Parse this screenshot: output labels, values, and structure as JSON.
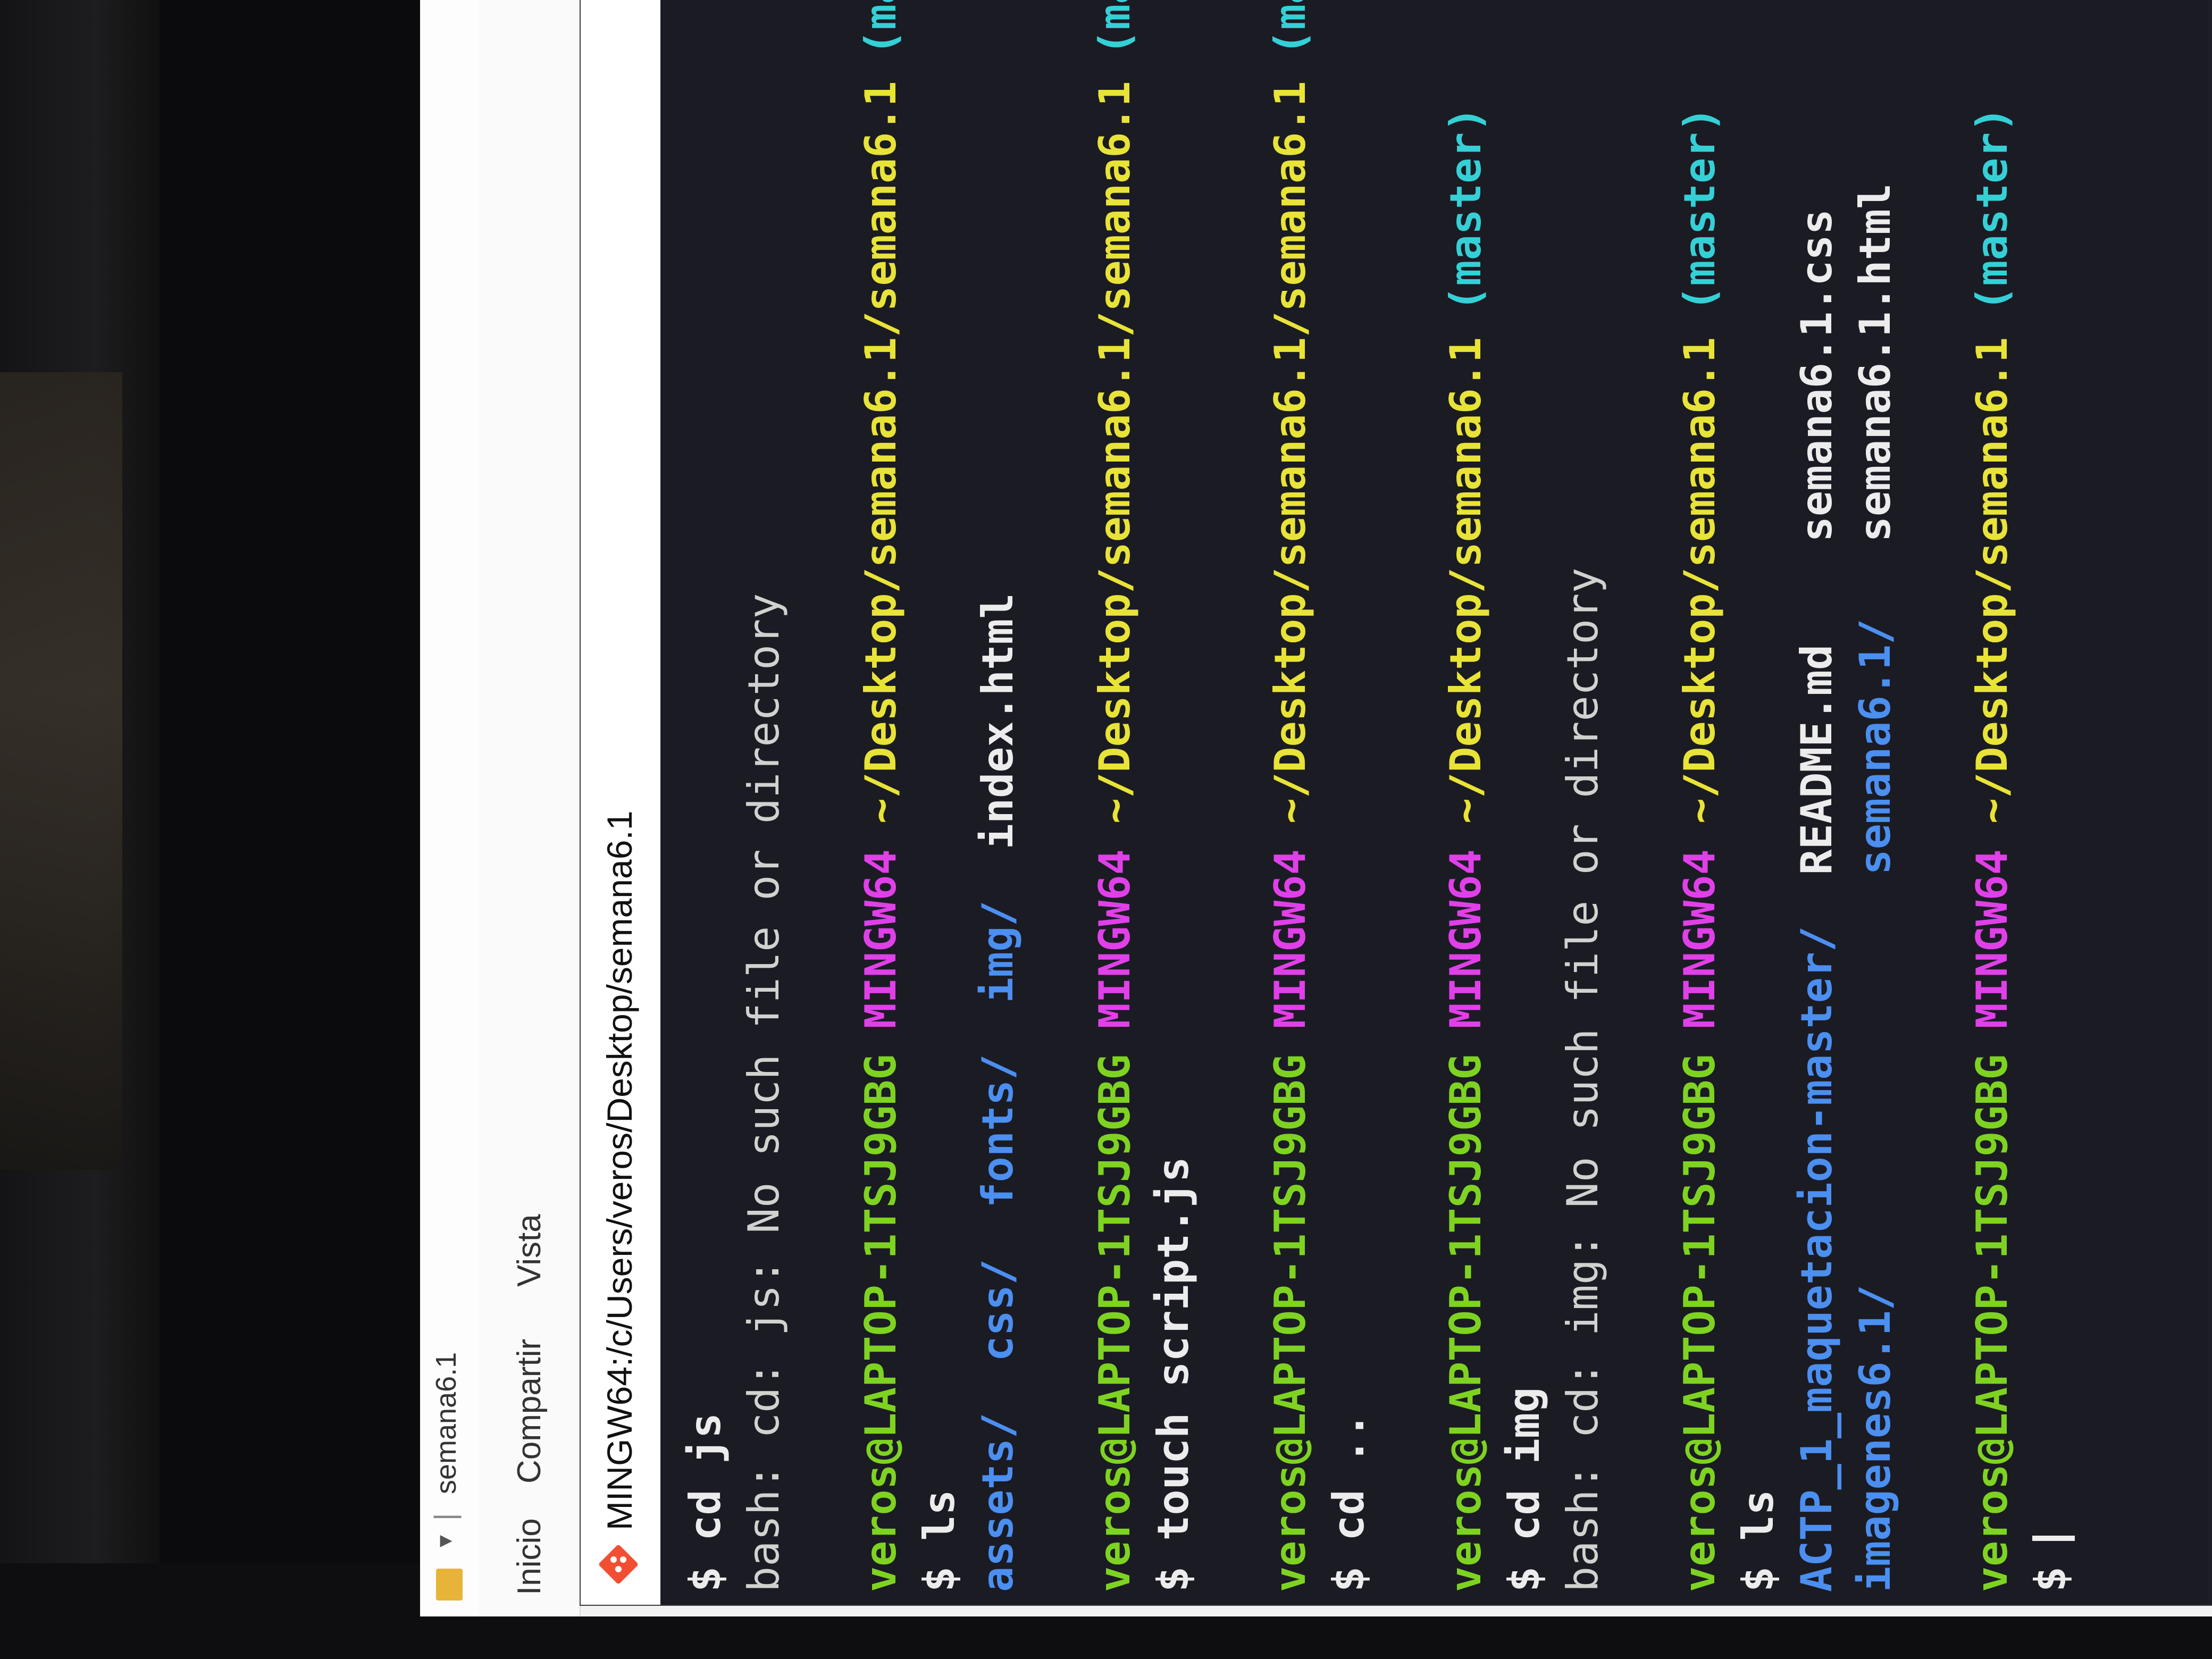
{
  "explorer": {
    "title": "semana6.1",
    "ribbon_tabs": [
      "Inicio",
      "Compartir",
      "Vista"
    ]
  },
  "terminal": {
    "title": "MINGW64:/c/Users/veros/Desktop/semana6.1",
    "minimize": "—",
    "prompt": {
      "user": "veros@LAPTOP-1TSJ9GBG",
      "system": "MINGW64",
      "branch": "(master)"
    },
    "lines": [
      {
        "kind": "cmd",
        "text": "$ cd js"
      },
      {
        "kind": "out",
        "text": "bash: cd: js: No such file or directory"
      },
      {
        "kind": "blank",
        "text": ""
      },
      {
        "kind": "prompt",
        "path": "~/Desktop/semana6.1/semana6.1"
      },
      {
        "kind": "cmd",
        "text": "$ ls"
      },
      {
        "kind": "ls1"
      },
      {
        "kind": "blank",
        "text": ""
      },
      {
        "kind": "prompt",
        "path": "~/Desktop/semana6.1/semana6.1"
      },
      {
        "kind": "cmd",
        "text": "$ touch script.js"
      },
      {
        "kind": "blank",
        "text": ""
      },
      {
        "kind": "prompt",
        "path": "~/Desktop/semana6.1/semana6.1"
      },
      {
        "kind": "cmd",
        "text": "$ cd .."
      },
      {
        "kind": "blank",
        "text": ""
      },
      {
        "kind": "prompt",
        "path": "~/Desktop/semana6.1"
      },
      {
        "kind": "cmd",
        "text": "$ cd img"
      },
      {
        "kind": "out",
        "text": "bash: cd: img: No such file or directory"
      },
      {
        "kind": "blank",
        "text": ""
      },
      {
        "kind": "prompt",
        "path": "~/Desktop/semana6.1"
      },
      {
        "kind": "cmd",
        "text": "$ ls"
      },
      {
        "kind": "ls2a"
      },
      {
        "kind": "ls2b"
      },
      {
        "kind": "blank",
        "text": ""
      },
      {
        "kind": "prompt",
        "path": "~/Desktop/semana6.1"
      },
      {
        "kind": "final",
        "text": "$ "
      }
    ],
    "ls1": [
      "assets/",
      "css/",
      "fonts/",
      "img/",
      "index.html"
    ],
    "ls2_row1": [
      "ACTP_1_maquetacion-master/",
      "README.md",
      "semana6.1.css"
    ],
    "ls2_row2": [
      "imagenes6.1/",
      "semana6.1/",
      "semana6.1.html"
    ],
    "colors": {
      "user": "#7ed321",
      "system": "#e040e8",
      "path": "#e8e337",
      "branch": "#35d0d6",
      "dir": "#4b8ff0"
    }
  }
}
